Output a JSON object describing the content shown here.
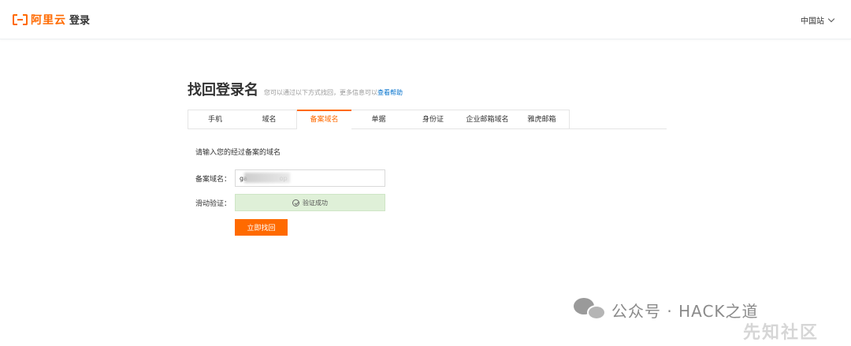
{
  "header": {
    "logo_text": "阿里云",
    "page_name": "登录",
    "site_switch": "中国站"
  },
  "main": {
    "title": "找回登录名",
    "subtitle": "您可以通过以下方式找回，更多信息可以",
    "help_link": "查看帮助",
    "tabs": [
      {
        "label": "手机"
      },
      {
        "label": "域名"
      },
      {
        "label": "备案域名"
      },
      {
        "label": "单据"
      },
      {
        "label": "身份证"
      },
      {
        "label": "企业邮箱域名"
      },
      {
        "label": "雅虎邮箱"
      }
    ],
    "active_tab": "备案域名",
    "hint": "请输入您的经过备案的域名",
    "domain_label": "备案域名：",
    "domain_value": "ga                op",
    "slider_label": "滑动验证：",
    "slider_status": "验证成功",
    "submit_label": "立即找回"
  },
  "watermark": {
    "text": "公众号 · HACK之道",
    "sub": "先知社区"
  },
  "colors": {
    "accent": "#ff6a00",
    "link": "#0070cc",
    "success_bg": "#dff0d8"
  }
}
